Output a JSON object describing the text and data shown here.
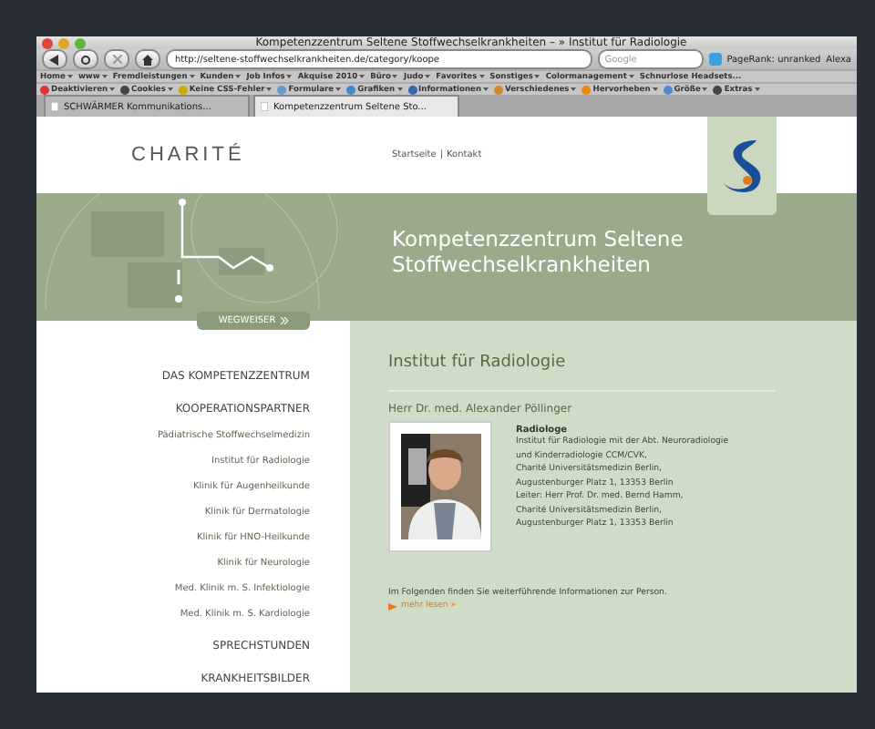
{
  "window": {
    "title": "Kompetenzzentrum Seltene Stoffwechselkrankheiten – » Institut für Radiologie"
  },
  "toolbar": {
    "url": "http://seltene-stoffwechselkrankheiten.de/category/koope",
    "search_placeholder": "Google",
    "pagerank": "PageRank: unranked",
    "extra": "Alexa"
  },
  "bookmarks": [
    "Home",
    "www",
    "Fremdleistungen",
    "Kunden",
    "Job Infos",
    "Akquise 2010",
    "Büro",
    "Judo",
    "Favorites",
    "Sonstiges",
    "Colormanagement",
    "Schnurlose Headsets..."
  ],
  "devtools": [
    "Deaktivieren",
    "Cookies",
    "Keine CSS-Fehler",
    "Formulare",
    "Grafiken",
    "Informationen",
    "Verschiedenes",
    "Hervorheben",
    "Größe",
    "Extras"
  ],
  "tabs": [
    {
      "label": "SCHWÄRMER Kommunikations...",
      "selected": false
    },
    {
      "label": "Kompetenzzentrum Seltene Sto...",
      "selected": true
    }
  ],
  "page": {
    "logo": "CHARITÉ",
    "header_links": [
      "Startseite",
      "Kontakt"
    ],
    "separator": "|",
    "banner_title": [
      "Kompetenzzentrum Seltene",
      "Stoffwechselkrankheiten"
    ],
    "guide_button": "WEGWEISER",
    "sidebar": [
      {
        "kind": "section",
        "label": "DAS KOMPETENZZENTRUM"
      },
      {
        "kind": "section",
        "label": "KOOPERATIONSPARTNER"
      },
      {
        "kind": "sub",
        "label": "Pädiatrische Stoffwechselmedizin"
      },
      {
        "kind": "sub",
        "label": "Institut für Radiologie"
      },
      {
        "kind": "sub",
        "label": "Klinik für Augenheilkunde"
      },
      {
        "kind": "sub",
        "label": "Klinik für Dermatologie"
      },
      {
        "kind": "sub",
        "label": "Klinik für HNO-Heilkunde"
      },
      {
        "kind": "sub",
        "label": "Klinik für Neurologie"
      },
      {
        "kind": "sub",
        "label": "Med. Klinik m. S. Infektiologie"
      },
      {
        "kind": "sub",
        "label": "Med. Klinik m. S. Kardiologie"
      },
      {
        "kind": "section",
        "label": "SPRECHSTUNDEN"
      },
      {
        "kind": "section",
        "label": "KRANKHEITSBILDER"
      }
    ],
    "heading": "Institut für Radiologie",
    "person": "Herr Dr. med. Alexander Pöllinger",
    "role": "Radiologe",
    "details": [
      "Institut für Radiologie mit der Abt. Neuroradiologie",
      "und Kinderradiologie CCM/CVK,",
      "Charité Universitätsmedizin Berlin,",
      "Augustenburger Platz 1, 13353 Berlin",
      "Leiter: Herr Prof. Dr. med. Bernd Hamm,",
      "Charité Universitätsmedizin Berlin,",
      "Augustenburger Platz 1, 13353 Berlin"
    ],
    "note": "Im Folgenden finden Sie weiterführende Informationen zur Person.",
    "more_link": "mehr lesen »"
  }
}
